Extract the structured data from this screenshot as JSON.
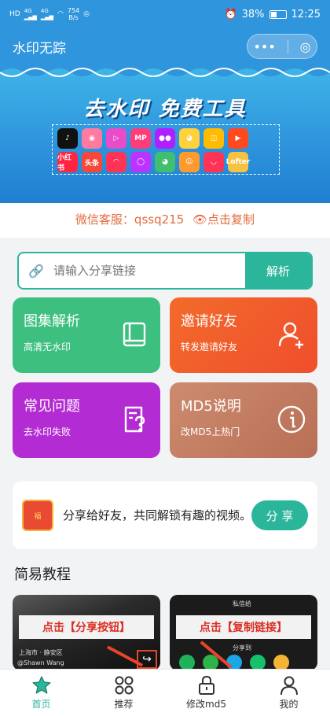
{
  "status_bar": {
    "sim_left": "HD",
    "signal1": "4G",
    "signal2": "4G",
    "net_speed": "754",
    "net_unit": "B/s",
    "battery": "38%",
    "time": "12:25"
  },
  "header": {
    "title": "水印无踪",
    "capsule_more": "•••",
    "capsule_close": "◎"
  },
  "banner": {
    "title_main": "去水印",
    "title_free": "免费工具",
    "apps": [
      {
        "label": "♪",
        "color": "#111111"
      },
      {
        "label": "◉",
        "color": "#ff7aa0"
      },
      {
        "label": "▷",
        "color": "#e94cc8"
      },
      {
        "label": "MP",
        "color": "#ff3d7a"
      },
      {
        "label": "●●",
        "color": "#b01fff"
      },
      {
        "label": "◕",
        "color": "#ffd13d"
      },
      {
        "label": "◫",
        "color": "#ffbb00"
      },
      {
        "label": "▶",
        "color": "#ff4a1f"
      },
      {
        "label": "",
        "color": "transparent"
      },
      {
        "label": "小红书",
        "color": "#ff2442"
      },
      {
        "label": "头条",
        "color": "#f5483b"
      },
      {
        "label": "◠",
        "color": "#ff3355"
      },
      {
        "label": "◯",
        "color": "#bb33ff"
      },
      {
        "label": "◕",
        "color": "#3fbf6f"
      },
      {
        "label": "☺",
        "color": "#ff9a2e"
      },
      {
        "label": "◡",
        "color": "#ff3355"
      },
      {
        "label": "Lofter",
        "color": "#f5c242"
      }
    ]
  },
  "service": {
    "label": "微信客服：qssq215",
    "copy": "👁点击复制"
  },
  "search": {
    "placeholder": "请输入分享链接",
    "button": "解析"
  },
  "tiles": {
    "album": {
      "title": "图集解析",
      "sub": "高清无水印"
    },
    "invite": {
      "title": "邀请好友",
      "sub": "转发邀请好友"
    },
    "faq": {
      "title": "常见问题",
      "sub": "去水印失败"
    },
    "md5": {
      "title": "MD5说明",
      "sub": "改MD5上热门"
    }
  },
  "share": {
    "img_text": "福",
    "text": "分享给好友，共同解锁有趣的视频。",
    "button": "分 享"
  },
  "tutorial": {
    "title": "简易教程",
    "card1_label": "点击【分享按钮】",
    "card1_note": "@Shawn Wang",
    "card1_loc": "上海市 · 静安区",
    "card2_label": "点击【复制链接】",
    "card2_top": "私信给",
    "card2_mid": "分享到"
  },
  "tabs": [
    {
      "label": "首页",
      "active": true
    },
    {
      "label": "推荐",
      "active": false
    },
    {
      "label": "修改md5",
      "active": false
    },
    {
      "label": "我的",
      "active": false
    }
  ],
  "colors": {
    "primary": "#2f95dd",
    "accent": "#2bb59a",
    "service": "#e26b3c"
  }
}
